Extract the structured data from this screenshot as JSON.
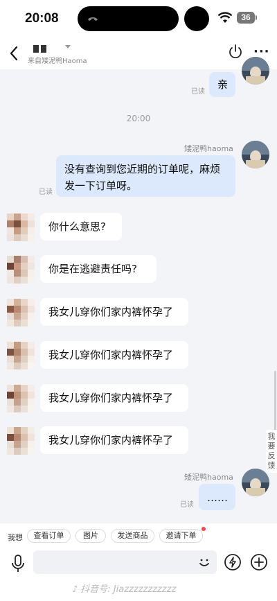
{
  "status_bar": {
    "time": "20:08",
    "battery": "36"
  },
  "header": {
    "subtitle": "来自矮泥鸭Haoma",
    "more_label": "···"
  },
  "messages": {
    "top_bubble": {
      "text": "亲",
      "status": "已读"
    },
    "timestamp": "20:00",
    "reply1": {
      "sender": "矮泥鸭haoma",
      "text": "没有查询到您近期的订单呢，麻烦发一下订单呀。",
      "status": "已读"
    },
    "incoming": [
      {
        "text": "你什么意思?"
      },
      {
        "text": "你是在逃避责任吗?"
      },
      {
        "text": "我女儿穿你们家内裤怀孕了"
      },
      {
        "text": "我女儿穿你们家内裤怀孕了"
      },
      {
        "text": "我女儿穿你们家内裤怀孕了"
      },
      {
        "text": "我女儿穿你们家内裤怀孕了"
      }
    ],
    "reply2": {
      "sender": "矮泥鸭haoma",
      "text": "……",
      "status": "已读"
    }
  },
  "side_tag": "我要反馈",
  "quick_replies": {
    "label": "我想",
    "chips": [
      "查看订单",
      "图片",
      "发送商品",
      "邀请下单"
    ]
  },
  "input": {
    "placeholder": "",
    "emoji_label": "☺"
  },
  "watermark": "抖音号: Jiazzzzzzzzzzz",
  "colors": {
    "outgoing_bubble": "#dce8fb",
    "incoming_bubble": "#ffffff",
    "background": "#f3f4f8"
  }
}
